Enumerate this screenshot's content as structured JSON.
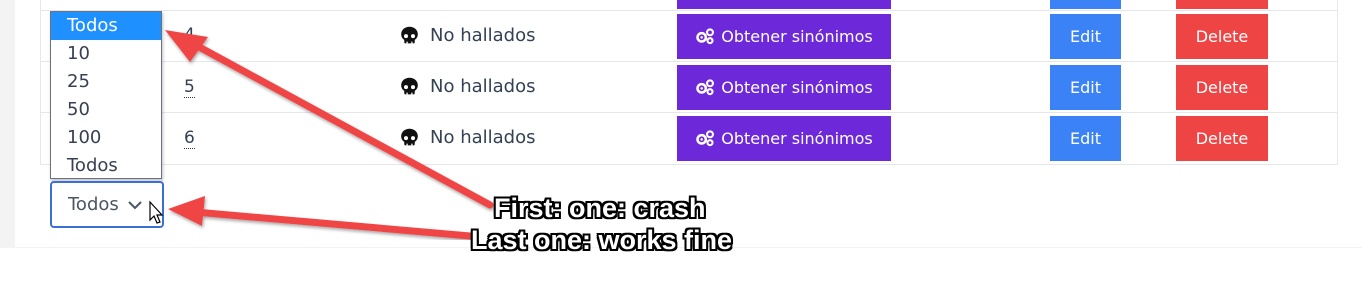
{
  "table": {
    "rows": [
      {
        "num": "4",
        "status": "No hallados",
        "synonyms_label": "Obtener sinónimos",
        "edit_label": "Edit",
        "delete_label": "Delete"
      },
      {
        "num": "5",
        "status": "No hallados",
        "synonyms_label": "Obtener sinónimos",
        "edit_label": "Edit",
        "delete_label": "Delete"
      },
      {
        "num": "6",
        "status": "No hallados",
        "synonyms_label": "Obtener sinónimos",
        "edit_label": "Edit",
        "delete_label": "Delete"
      }
    ]
  },
  "page_size_dropdown": {
    "options": [
      "Todos",
      "10",
      "25",
      "50",
      "100",
      "Todos"
    ],
    "highlighted_index": 0
  },
  "page_size_select": {
    "value": "Todos"
  },
  "annotations": {
    "line1": "First: one: crash",
    "line2": "Last one: works fine"
  },
  "colors": {
    "synonyms_button": "#6d28d9",
    "edit_button": "#3b82f6",
    "delete_button": "#ef4444",
    "arrow": "#f04545",
    "highlight": "#1e90ff"
  },
  "icons": {
    "status": "skull-icon",
    "synonyms": "gears-icon",
    "select": "chevron-down-icon",
    "cursor": "mouse-cursor-icon"
  }
}
